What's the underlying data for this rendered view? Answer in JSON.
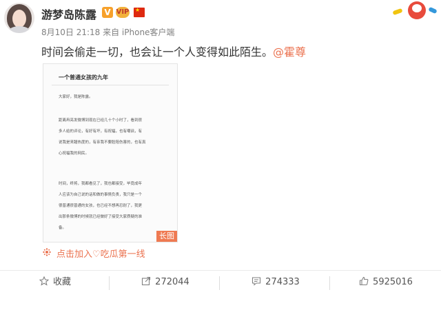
{
  "post": {
    "username": "游梦岛陈露",
    "badges": {
      "verified": "V",
      "vip": "VIP"
    },
    "meta": "8月10日 21:18 来自 iPhone客户端",
    "text": "时间会偷走一切，也会让一个人变得如此陌生。",
    "mention": "@霍尊",
    "long_image": {
      "title": "一个普通女孩的九年",
      "lines": [
        "大家好，我是陈露。",
        "",
        "距离冉亮发微博到现在已经几十个小时了，看到很",
        "多人给的评论，有好有坏，有祝福，也有嘲讽，有",
        "说我是来蹭热度的，有亲我不要脸陪伤害的，也有真",
        "心祝福我的网民。",
        "",
        "时间，终将，我都看见了，我也都接受，毕竟成年",
        "人应该为自己说的话和做的事情负责，我只是一个",
        "很普通很普通的女孩，也已经不想再忍耐了，我更",
        "出那条微博的时候就已经做好了接受大家质疑的准",
        "备。"
      ],
      "badge": "长图"
    },
    "tagline": "点击加入♡吃瓜第一线"
  },
  "actions": {
    "favorite": "收藏",
    "repost": "272044",
    "comment": "274333",
    "like": "5925016"
  },
  "colors": {
    "accent": "#eb7350",
    "text": "#333333",
    "meta": "#808080"
  },
  "icons": {
    "favorite": "star-outline",
    "repost": "share-arrow",
    "comment": "comment-bubble",
    "like": "thumbs-up"
  }
}
